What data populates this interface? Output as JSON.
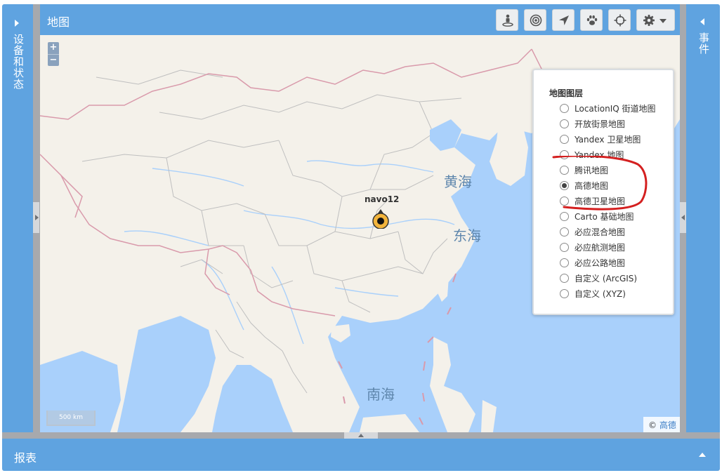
{
  "left_panel": {
    "title": "设备和状态"
  },
  "right_panel": {
    "title": "事件"
  },
  "map_panel": {
    "title": "地图",
    "toolbar_icons": [
      "street-view-icon",
      "geofence-icon",
      "navigation-arrow-icon",
      "paw-icon",
      "crosshair-icon",
      "gear-icon"
    ]
  },
  "map": {
    "zoom_in": "+",
    "zoom_out": "−",
    "seas": {
      "yellow_sea": "黄海",
      "east_sea": "东海",
      "south_sea": "南海"
    },
    "marker": {
      "label": "navo12"
    },
    "scale": "500 km",
    "attribution": {
      "symbol": "©",
      "provider": "高德"
    }
  },
  "layers": {
    "title": "地图图层",
    "items": [
      {
        "label": "LocationIQ 街道地图",
        "selected": false
      },
      {
        "label": "开放街景地图",
        "selected": false
      },
      {
        "label": "Yandex 卫星地图",
        "selected": false
      },
      {
        "label": "Yandex 地图",
        "selected": false
      },
      {
        "label": "腾讯地图",
        "selected": false
      },
      {
        "label": "高德地图",
        "selected": true
      },
      {
        "label": "高德卫星地图",
        "selected": false
      },
      {
        "label": "Carto 基础地图",
        "selected": false
      },
      {
        "label": "必应混合地图",
        "selected": false
      },
      {
        "label": "必应航测地图",
        "selected": false
      },
      {
        "label": "必应公路地图",
        "selected": false
      },
      {
        "label": "自定义 (ArcGIS)",
        "selected": false
      },
      {
        "label": "自定义 (XYZ)",
        "selected": false
      }
    ]
  },
  "reports": {
    "title": "报表"
  },
  "colors": {
    "panel_blue": "#5fa3e0",
    "sea": "#a9d0fb",
    "land": "#f4f1ea",
    "annotation": "#d42020"
  }
}
